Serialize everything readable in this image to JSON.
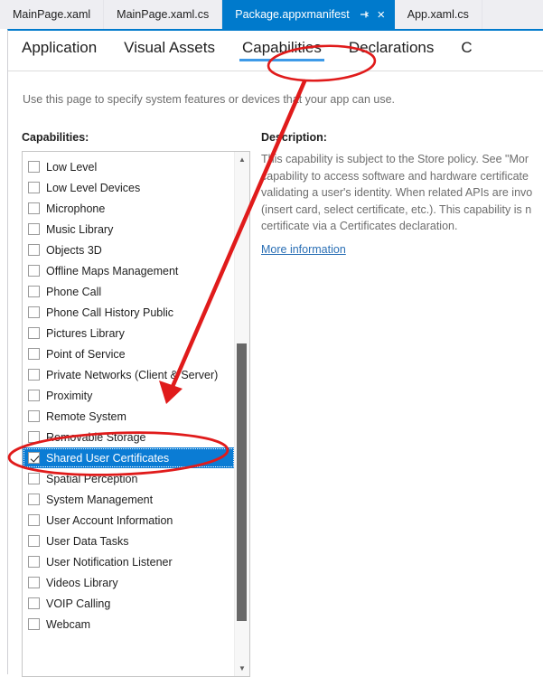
{
  "tabstrip": {
    "tabs": [
      {
        "label": "MainPage.xaml",
        "active": false
      },
      {
        "label": "MainPage.xaml.cs",
        "active": false
      },
      {
        "label": "Package.appxmanifest",
        "active": true
      },
      {
        "label": "App.xaml.cs",
        "active": false
      }
    ],
    "pin_icon": "pin-icon",
    "close_icon": "×"
  },
  "designer": {
    "nav_tabs": [
      {
        "label": "Application",
        "selected": false
      },
      {
        "label": "Visual Assets",
        "selected": false
      },
      {
        "label": "Capabilities",
        "selected": true
      },
      {
        "label": "Declarations",
        "selected": false
      },
      {
        "label": "C",
        "selected": false
      }
    ],
    "intro_text": "Use this page to specify system features or devices that your app can use.",
    "capabilities_header": "Capabilities:",
    "description_header": "Description:",
    "description_lines": [
      "This capability is subject to the Store policy. See \"Mor",
      "capability to access software and hardware certificate",
      "validating a user's identity. When related APIs are invo",
      "(insert card, select certificate, etc.). This capability is n",
      "certificate via a Certificates declaration."
    ],
    "more_information_link": "More information",
    "capabilities": [
      {
        "label": "Low Level",
        "checked": false,
        "selected": false
      },
      {
        "label": "Low Level Devices",
        "checked": false,
        "selected": false
      },
      {
        "label": "Microphone",
        "checked": false,
        "selected": false
      },
      {
        "label": "Music Library",
        "checked": false,
        "selected": false
      },
      {
        "label": "Objects 3D",
        "checked": false,
        "selected": false
      },
      {
        "label": "Offline Maps Management",
        "checked": false,
        "selected": false
      },
      {
        "label": "Phone Call",
        "checked": false,
        "selected": false
      },
      {
        "label": "Phone Call History Public",
        "checked": false,
        "selected": false
      },
      {
        "label": "Pictures Library",
        "checked": false,
        "selected": false
      },
      {
        "label": "Point of Service",
        "checked": false,
        "selected": false
      },
      {
        "label": "Private Networks (Client & Server)",
        "checked": false,
        "selected": false
      },
      {
        "label": "Proximity",
        "checked": false,
        "selected": false
      },
      {
        "label": "Remote System",
        "checked": false,
        "selected": false
      },
      {
        "label": "Removable Storage",
        "checked": false,
        "selected": false
      },
      {
        "label": "Shared User Certificates",
        "checked": true,
        "selected": true
      },
      {
        "label": "Spatial Perception",
        "checked": false,
        "selected": false
      },
      {
        "label": "System Management",
        "checked": false,
        "selected": false
      },
      {
        "label": "User Account Information",
        "checked": false,
        "selected": false
      },
      {
        "label": "User Data Tasks",
        "checked": false,
        "selected": false
      },
      {
        "label": "User Notification Listener",
        "checked": false,
        "selected": false
      },
      {
        "label": "Videos Library",
        "checked": false,
        "selected": false
      },
      {
        "label": "VOIP Calling",
        "checked": false,
        "selected": false
      },
      {
        "label": "Webcam",
        "checked": false,
        "selected": false
      }
    ],
    "scrollbar": {
      "up_arrow_icon": "▲",
      "down_arrow_icon": "▼"
    }
  },
  "annotations": {
    "accent_color": "#e01b1b",
    "ellipse_capabilities_tab": "red-ellipse-around-capabilities-tab",
    "ellipse_selected_row": "red-ellipse-around-shared-user-certificates",
    "arrow": "red-arrow-pointing-to-shared-user-certificates"
  },
  "colors": {
    "active_tab_blue": "#007acc",
    "selection_blue": "#0b7cd4",
    "underline_blue": "#3d9ae8",
    "link_blue": "#2a6fb5",
    "annotation_red": "#e01b1b"
  }
}
